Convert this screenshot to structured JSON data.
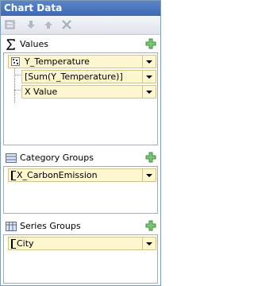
{
  "panel": {
    "title": "Chart Data"
  },
  "toolbar": {
    "buttons": [
      {
        "name": "properties-icon"
      },
      {
        "name": "move-down-icon"
      },
      {
        "name": "move-up-icon"
      },
      {
        "name": "delete-icon"
      }
    ]
  },
  "values": {
    "header": "Values",
    "icon": "sigma-icon",
    "series_field": "Y_Temperature",
    "y_value": "[Sum(Y_Temperature)]",
    "x_value": "X Value"
  },
  "category_groups": {
    "header": "Category Groups",
    "icon": "category-groups-icon",
    "field": "X_CarbonEmission"
  },
  "series_groups": {
    "header": "Series Groups",
    "icon": "series-groups-icon",
    "field": "City"
  },
  "colors": {
    "title_bar": "#4a74bf",
    "field_bg": "#fdf6cf",
    "add_icon": "#5cb85c"
  }
}
